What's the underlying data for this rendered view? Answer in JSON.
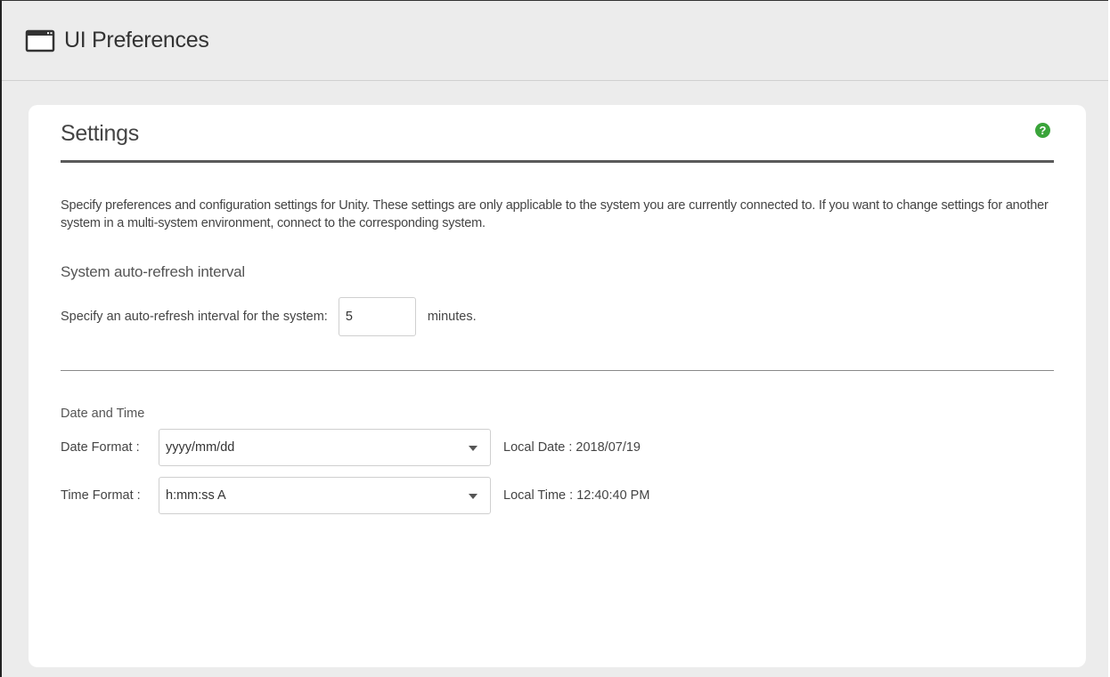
{
  "window": {
    "title": "UI Preferences"
  },
  "settings": {
    "title": "Settings",
    "help_icon": "help-icon",
    "help_glyph": "?",
    "description": "Specify preferences and configuration settings for Unity. These settings are only applicable to the system you are currently connected to. If you want to change settings for another system in a multi-system environment, connect to the corresponding system."
  },
  "auto_refresh": {
    "heading": "System auto-refresh interval",
    "label": "Specify an auto-refresh interval for the system:",
    "value": "5",
    "unit": "minutes."
  },
  "date_time": {
    "heading": "Date and Time",
    "date_format_label": "Date Format :",
    "date_format_value": "yyyy/mm/dd",
    "local_date": "Local Date : 2018/07/19",
    "time_format_label": "Time Format :",
    "time_format_value": "h:mm:ss A",
    "local_time": "Local Time : 12:40:40 PM"
  },
  "colors": {
    "help_green": "#3aa43a",
    "page_background": "#ececec",
    "card_background": "#ffffff"
  }
}
